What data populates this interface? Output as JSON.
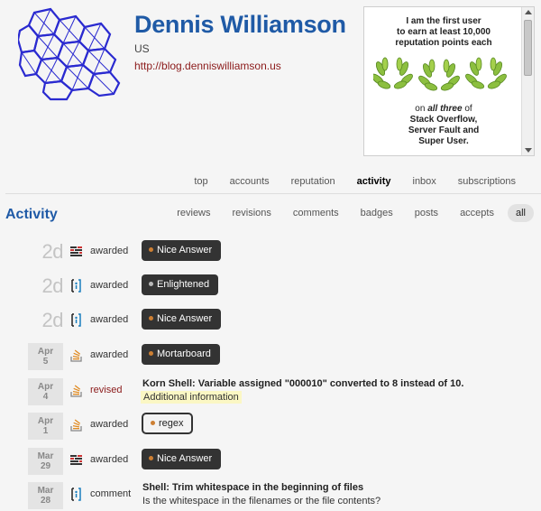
{
  "profile": {
    "name": "Dennis Williamson",
    "location": "US",
    "website": "http://blog.denniswilliamson.us"
  },
  "about": {
    "intro": "I am the first user\nto earn at least 10,000\nreputation points each",
    "on": "on",
    "all_three": "all three",
    "of": "of",
    "sites_line1": "Stack Overflow,",
    "sites_line2": "Server Fault and",
    "sites_line3": "Super User."
  },
  "main_tabs": [
    {
      "label": "top",
      "active": false
    },
    {
      "label": "accounts",
      "active": false
    },
    {
      "label": "reputation",
      "active": false
    },
    {
      "label": "activity",
      "active": true
    },
    {
      "label": "inbox",
      "active": false
    },
    {
      "label": "subscriptions",
      "active": false
    }
  ],
  "section_title": "Activity",
  "sub_tabs": [
    {
      "label": "reviews",
      "active": false
    },
    {
      "label": "revisions",
      "active": false
    },
    {
      "label": "comments",
      "active": false
    },
    {
      "label": "badges",
      "active": false
    },
    {
      "label": "posts",
      "active": false
    },
    {
      "label": "accepts",
      "active": false
    },
    {
      "label": "all",
      "active": true
    }
  ],
  "colors": {
    "accent": "#1f5aa6",
    "link": "#8b1a1a",
    "bronze_dot": "#cd7f32",
    "silver_dot": "#b8b8b8",
    "highlight": "#fbf7c4"
  },
  "activities": [
    {
      "date": "2d",
      "date_style": "relative",
      "site": "serverfault-icon",
      "action": "awarded",
      "type": "badge",
      "badge": "Nice Answer",
      "badge_class": "bronze"
    },
    {
      "date": "2d",
      "date_style": "relative",
      "site": "superuser-icon",
      "action": "awarded",
      "type": "badge",
      "badge": "Enlightened",
      "badge_class": "silver"
    },
    {
      "date": "2d",
      "date_style": "relative",
      "site": "superuser-icon",
      "action": "awarded",
      "type": "badge",
      "badge": "Nice Answer",
      "badge_class": "bronze"
    },
    {
      "month": "Apr",
      "day": "5",
      "date_style": "box",
      "site": "stackoverflow-icon",
      "action": "awarded",
      "type": "badge",
      "badge": "Mortarboard",
      "badge_class": "bronze"
    },
    {
      "month": "Apr",
      "day": "4",
      "date_style": "box",
      "site": "stackoverflow-icon",
      "action": "revised",
      "type": "post",
      "title": "Korn Shell: Variable assigned \"000010\" converted to 8 instead of 10.",
      "note": "Additional information",
      "note_style": "highlight"
    },
    {
      "month": "Apr",
      "day": "1",
      "date_style": "box",
      "site": "stackoverflow-icon",
      "action": "awarded",
      "type": "tag",
      "badge": "regex",
      "badge_class": "bronze"
    },
    {
      "month": "Mar",
      "day": "29",
      "date_style": "box",
      "site": "serverfault-icon",
      "action": "awarded",
      "type": "badge",
      "badge": "Nice Answer",
      "badge_class": "bronze"
    },
    {
      "month": "Mar",
      "day": "28",
      "date_style": "box",
      "site": "superuser-icon",
      "action": "comment",
      "type": "post",
      "title": "Shell: Trim whitespace in the beginning of files",
      "note": "Is the whitespace in the filenames or the file contents?",
      "note_style": "plain"
    }
  ]
}
